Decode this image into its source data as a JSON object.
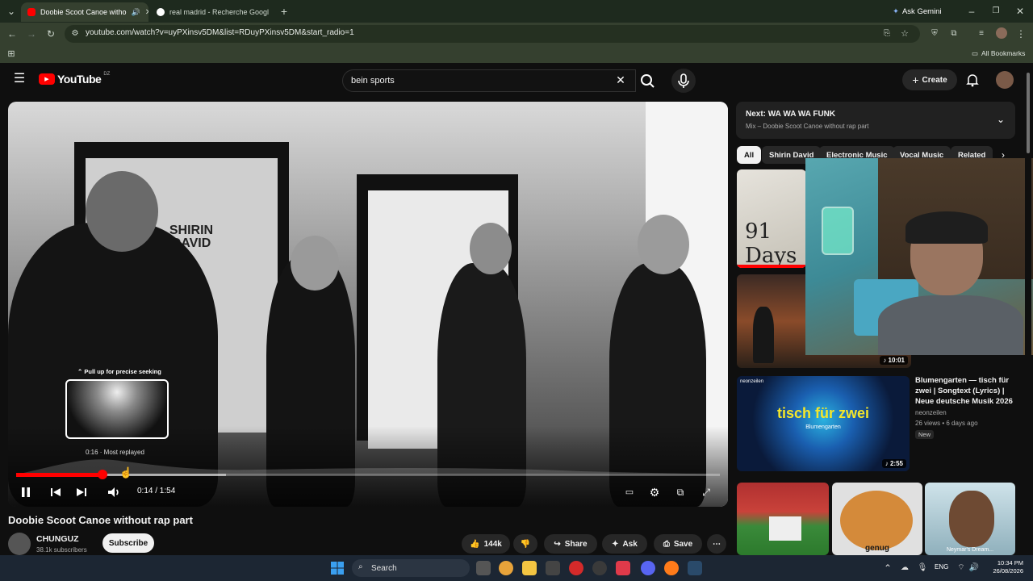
{
  "browser": {
    "tabs": [
      {
        "title": "Doobie Scoot Canoe witho",
        "active": true
      },
      {
        "title": "real madrid - Recherche Googl",
        "active": false
      }
    ],
    "ask_gemini": "Ask Gemini",
    "url": "youtube.com/watch?v=uyPXinsv5DM&list=RDuyPXinsv5DM&start_radio=1",
    "all_bookmarks": "All Bookmarks"
  },
  "youtube": {
    "logo": "YouTube",
    "region": "DZ",
    "search_value": "bein sports",
    "create_label": "Create"
  },
  "player": {
    "seek_hint": "Pull up for precise seeking",
    "most_replayed": "0:16 · Most replayed",
    "time": "0:14 / 1:54",
    "progress_fraction": 0.1228,
    "wall_sign": "SHIRIN DAVID"
  },
  "video": {
    "title": "Doobie Scoot Canoe without rap part",
    "channel": "CHUNGUZ",
    "subscribers": "38.1k subscribers",
    "subscribe_label": "Subscribe",
    "likes": "144k",
    "share_label": "Share",
    "ask_label": "Ask",
    "save_label": "Save"
  },
  "sidebar": {
    "up_next_prefix": "Next:",
    "up_next_title": "WA WA WA FUNK",
    "up_next_sub": "Mix – Doobie Scoot Canoe without rap part",
    "chips": [
      "All",
      "Shirin David",
      "Electronic Music",
      "Vocal Music",
      "Related"
    ],
    "items": [
      {
        "thumb_text": "91 Days",
        "duration": ""
      },
      {
        "duration": "10:01"
      },
      {
        "title": "Blumengarten — tisch für zwei | Songtext (Lyrics) | Neue deutsche Musik 2026",
        "channel": "neonzeilen",
        "meta": "26 views • 6 days ago",
        "badge": "New",
        "duration": "2:55",
        "thumb_title": "tisch für zwei",
        "thumb_sub": "Blumengarten",
        "thumb_channel": "neonzeilen"
      }
    ],
    "shorts": [
      {
        "caption": ""
      },
      {
        "caption": "genug"
      },
      {
        "caption": "Neymar's Dream..."
      }
    ]
  },
  "taskbar": {
    "search_label": "Search",
    "lang": "ENG",
    "time": "10:34 PM",
    "date": "26/08/2026"
  }
}
